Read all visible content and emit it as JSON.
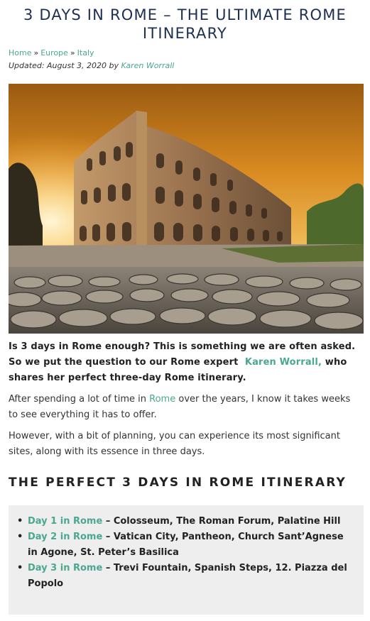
{
  "header": {
    "title": "3 DAYS IN ROME – THE ULTIMATE ROME ITINERARY"
  },
  "breadcrumb": {
    "items": [
      "Home",
      "Europe",
      "Italy"
    ],
    "separator": "»"
  },
  "meta": {
    "updated_prefix": "Updated: August 3, 2020 by",
    "author": "Karen Worrall"
  },
  "hero": {
    "alt": "Colosseum at sunset"
  },
  "intro": {
    "lead_text": "Is 3 days in Rome enough? This is something we are often asked. So we put the question to our Rome expert",
    "lead_link": "Karen Worrall,",
    "lead_tail": "who shares her perfect three-day Rome itinerary.",
    "p2_before": "After spending a lot of time in",
    "p2_link": "Rome",
    "p2_after": "over the years, I know it takes weeks to see everything it has to offer.",
    "p3": "However, with a bit of planning, you can experience its most significant sites, along with its essence in three days."
  },
  "section": {
    "heading": "THE PERFECT 3 DAYS IN ROME ITINERARY"
  },
  "itinerary": [
    {
      "day": "Day 1 in Rome",
      "places": "– Colosseum, The Roman Forum, Palatine Hill"
    },
    {
      "day": "Day 2 in Rome",
      "places": "– Vatican City, Pantheon, Church Sant’Agnese in Agone, St. Peter’s Basilica"
    },
    {
      "day": "Day 3 in Rome",
      "places": "– Trevi Fountain, Spanish Steps, 12. Piazza del Popolo"
    }
  ],
  "colors": {
    "title": "#1d2f52",
    "link": "#4aa790",
    "box_bg": "#eeeeee"
  }
}
